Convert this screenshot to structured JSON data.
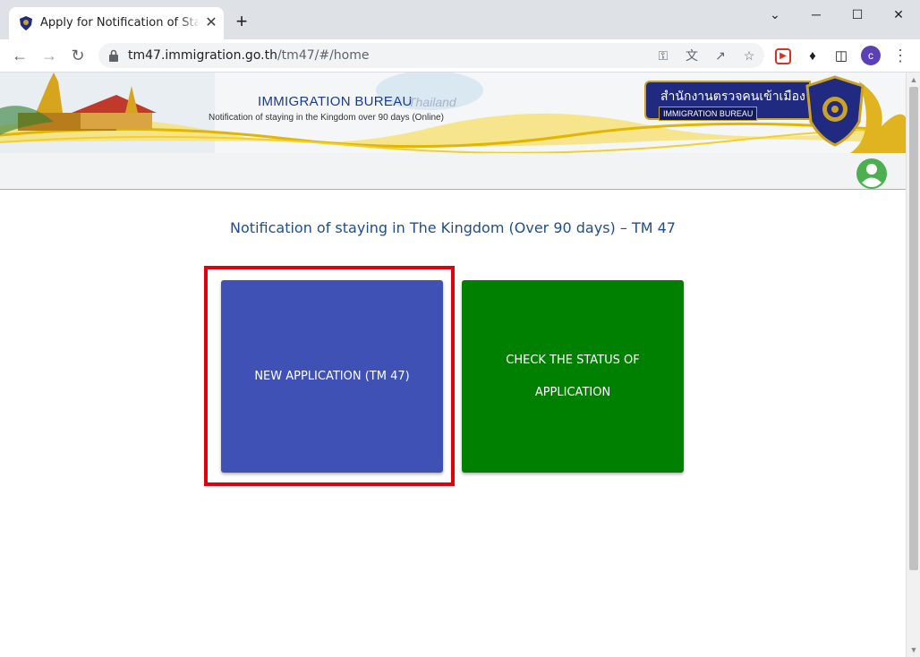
{
  "browser": {
    "tab_title": "Apply for Notification of Staying in the Kingdom",
    "close_tab_glyph": "✕",
    "new_tab_glyph": "+",
    "url_host": "tm47.immigration.go.th",
    "url_path": "/tm47/#/home",
    "profile_initial": "c",
    "window_controls": {
      "minimize": "─",
      "maximize": "☐",
      "close": "✕",
      "tab_search": "⌄"
    }
  },
  "header": {
    "bureau_title": "IMMIGRATION BUREAU",
    "bureau_country": "Thailand",
    "bureau_subtitle": "Notification of staying in the Kingdom over 90 days (Online)",
    "thai_agency_name": "สำนักงานตรวจคนเข้าเมือง",
    "english_agency_name": "IMMIGRATION BUREAU"
  },
  "main": {
    "heading": "Notification of staying in The Kingdom (Over 90 days) – TM 47",
    "new_application_label": "NEW APPLICATION (TM 47)",
    "check_status_line1": "CHECK THE STATUS OF",
    "check_status_line2": "APPLICATION"
  },
  "colors": {
    "new_application": "#3f51b5",
    "check_status": "#008000",
    "highlight": "#e0000b",
    "user_icon": "#4caf50"
  }
}
